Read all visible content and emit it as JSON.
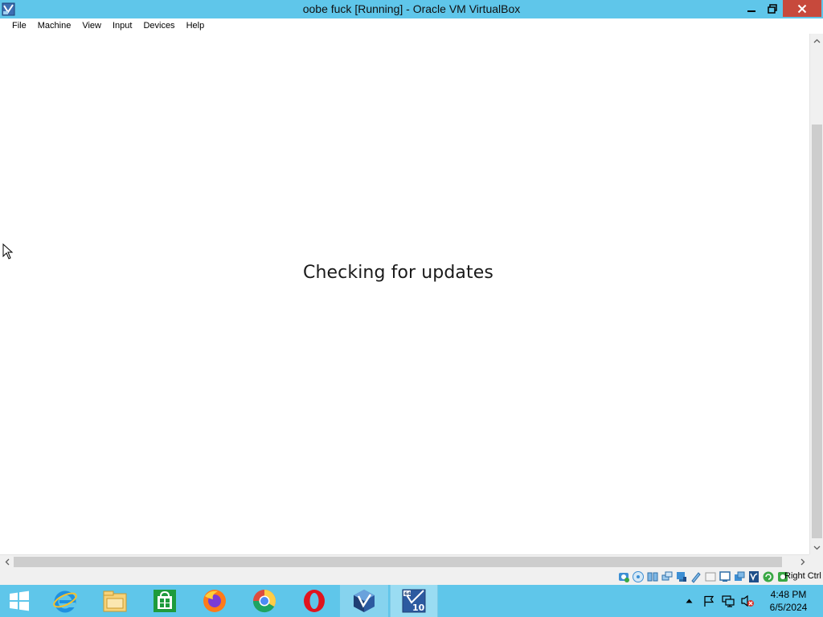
{
  "window": {
    "title": "oobe fuck [Running] - Oracle VM VirtualBox",
    "app_icon": "virtualbox-icon",
    "controls": [
      "minimize-icon",
      "restore-icon",
      "close-icon"
    ]
  },
  "menu": {
    "items": [
      "File",
      "Machine",
      "View",
      "Input",
      "Devices",
      "Help"
    ]
  },
  "vm": {
    "message": "Checking for updates",
    "scroll": {
      "vertical_position_fraction": 0.18,
      "horizontal_position_fraction": 0.0
    }
  },
  "statusbar": {
    "icons": [
      "hard-disk-icon",
      "optical-drive-icon",
      "audio-icon",
      "network-icon",
      "usb-icon",
      "shared-folders-icon",
      "display-icon",
      "recording-icon",
      "virtualization-icon",
      "mouse-integration-icon",
      "keyboard-icon"
    ],
    "host_key": "Right Ctrl"
  },
  "taskbar": {
    "start": "windows-start-icon",
    "apps": [
      {
        "name": "internet-explorer-icon"
      },
      {
        "name": "file-explorer-icon"
      },
      {
        "name": "store-icon"
      },
      {
        "name": "firefox-icon"
      },
      {
        "name": "chrome-icon"
      },
      {
        "name": "opera-icon"
      },
      {
        "name": "virtualbox-icon",
        "state": "running"
      },
      {
        "name": "vm-window-icon",
        "state": "active",
        "badge_top": "64",
        "badge_main": "10"
      }
    ],
    "tray": [
      "show-hidden-icons-icon",
      "action-center-flag-icon",
      "network-icon",
      "volume-muted-icon"
    ],
    "clock": {
      "time": "4:48 PM",
      "date": "6/5/2024"
    }
  },
  "colors": {
    "titlebar": "#5fc6ea",
    "taskbar": "#5fc6ea",
    "close_button": "#c7493c",
    "content_background": "#ffffff"
  }
}
